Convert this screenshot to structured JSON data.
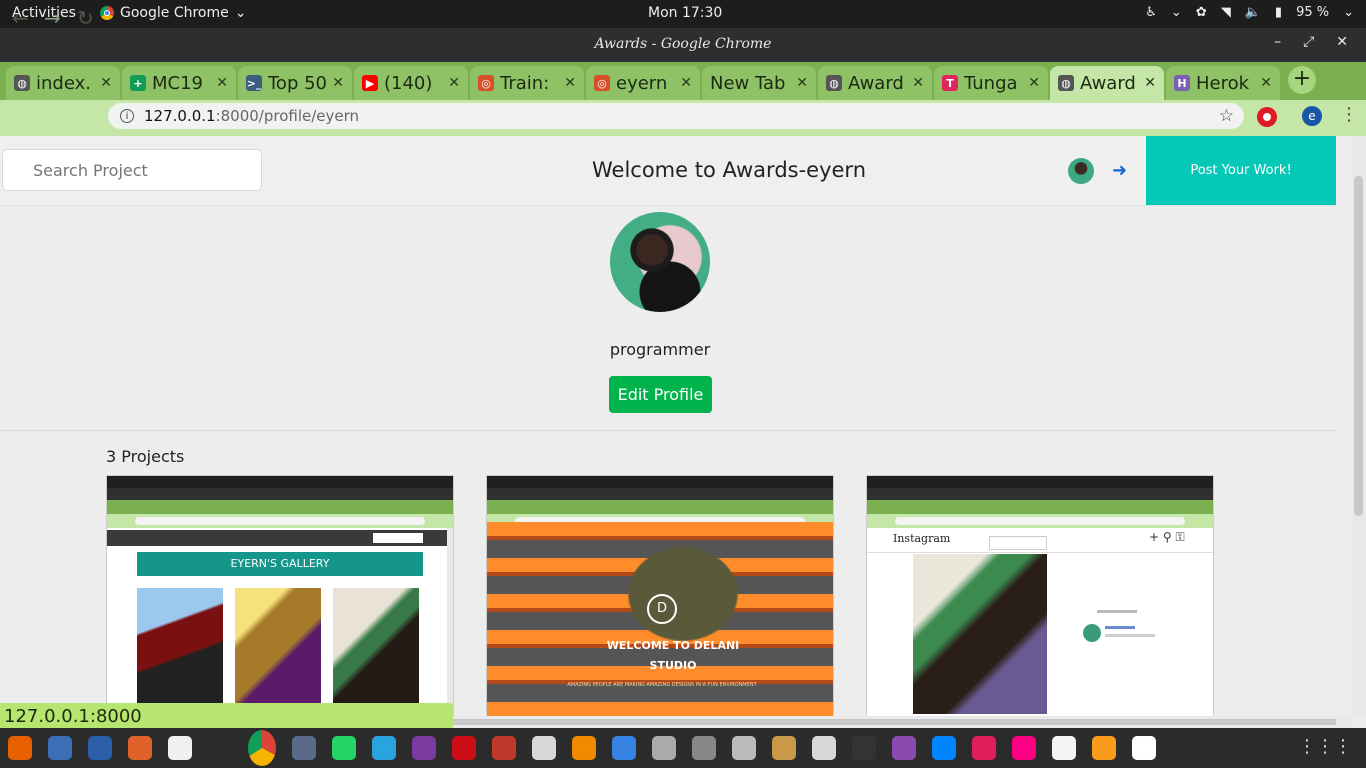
{
  "topbar": {
    "activities": "Activities",
    "app_name": "Google Chrome",
    "clock": "Mon 17:30",
    "battery": "95 %"
  },
  "window": {
    "title": "Awards - Google Chrome"
  },
  "tabs": [
    {
      "label": "index.",
      "icon": "globe-icon",
      "color": "#555555"
    },
    {
      "label": "MC19",
      "icon": "sheets-icon",
      "color": "#0f9d58"
    },
    {
      "label": "Top 50",
      "icon": "terminal-icon",
      "color": "#3a5f7d"
    },
    {
      "label": "(140)",
      "icon": "youtube-icon",
      "color": "#ff0000"
    },
    {
      "label": "Train:",
      "icon": "swirl-icon",
      "color": "#d6502a"
    },
    {
      "label": "eyern",
      "icon": "swirl-icon",
      "color": "#d6502a"
    },
    {
      "label": "New Tab",
      "icon": "",
      "color": ""
    },
    {
      "label": "Award",
      "icon": "globe-icon",
      "color": "#555555"
    },
    {
      "label": "Tunga",
      "icon": "tunga-icon",
      "color": "#e0245e"
    },
    {
      "label": "Award",
      "icon": "globe-icon",
      "color": "#555555"
    },
    {
      "label": "Herok",
      "icon": "heroku-icon",
      "color": "#7b5fb0"
    }
  ],
  "omnibox": {
    "host": "127.0.0.1",
    "path": ":8000/profile/eyern"
  },
  "page": {
    "search_placeholder": "Search Project",
    "welcome": "Welcome to Awards-eyern",
    "post_button": "Post Your Work!",
    "bio": "programmer",
    "edit_button": "Edit Profile",
    "project_count": "3 Projects"
  },
  "projects": [
    {
      "name": "EYERN'S GALLERY",
      "theme": "gallery"
    },
    {
      "name": "WELCOME TO DELANI STUDIO",
      "theme": "studio",
      "tagline": "AMAZING PEOPLE ARE MAKING AMAZING DESIGNS IN A FUN ENVIRONMENT"
    },
    {
      "name": "Instagram",
      "theme": "instagram"
    }
  ],
  "status_url": "127.0.0.1:8000",
  "colors": {
    "accent": "#05c8b6",
    "edit": "#00b34a",
    "tab_strip": "#7ab04f"
  },
  "dock": [
    "firefox-icon",
    "files-icon",
    "writer-icon",
    "software-icon",
    "amazon-icon",
    "terminal-icon",
    "chrome-icon",
    "tool-icon",
    "whatsapp-icon",
    "telegram-icon",
    "rss-icon",
    "opera-icon",
    "filezilla-icon",
    "solitaire-icon",
    "vlc-icon",
    "tasks-icon",
    "scanner-icon",
    "printer-icon",
    "settings-icon",
    "folder-icon",
    "doc-icon",
    "monitor-icon",
    "screenshot-icon",
    "messenger-icon",
    "slack-icon",
    "flickr-icon",
    "camera-icon",
    "sublime-icon",
    "debian-icon"
  ]
}
